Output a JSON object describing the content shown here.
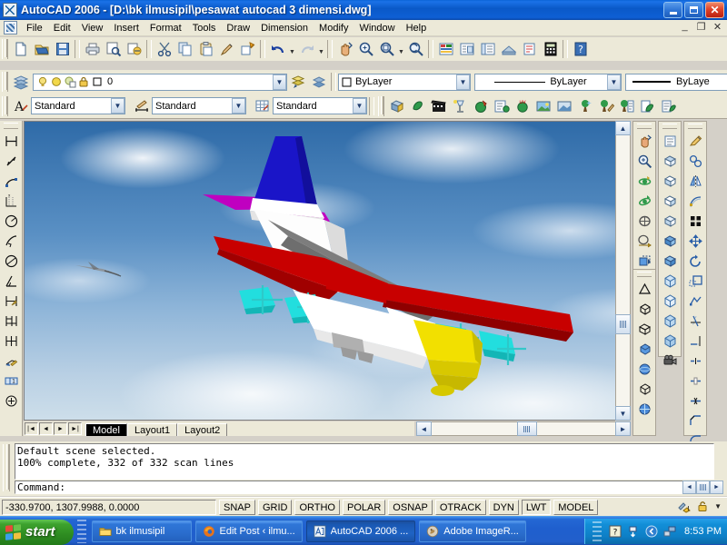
{
  "window": {
    "title": "AutoCAD 2006 - [D:\\bk ilmusipil\\pesawat autocad 3 dimensi.dwg]",
    "app_icon": "autocad-icon",
    "minimize_label": "Minimize",
    "maximize_label": "Restore",
    "close_label": "Close",
    "mdi_minimize": "_",
    "mdi_restore": "❐",
    "mdi_close": "✕"
  },
  "menu": {
    "doc_icon": "document-icon",
    "items": [
      "File",
      "Edit",
      "View",
      "Insert",
      "Format",
      "Tools",
      "Draw",
      "Dimension",
      "Modify",
      "Window",
      "Help"
    ]
  },
  "standard_toolbar": {
    "name": "standard-toolbar",
    "tools": [
      "new-file-icon",
      "open-file-icon",
      "save-icon",
      "plot-icon",
      "plot-preview-icon",
      "publish-icon",
      "cut-icon",
      "copy-icon",
      "paste-icon",
      "match-properties-icon",
      "block-editor-icon",
      "undo-icon",
      "redo-icon",
      "pan-realtime-icon",
      "zoom-realtime-icon",
      "zoom-window-icon",
      "zoom-previous-icon",
      "properties-icon",
      "designcenter-icon",
      "tool-palettes-icon",
      "sheet-set-icon",
      "markup-set-icon",
      "quickcalc-icon",
      "help-icon"
    ]
  },
  "layer_toolbar": {
    "name": "layers-toolbar",
    "layer_properties_icon": "layer-properties-icon",
    "state_icons": [
      "lightbulb-on-icon",
      "sun-freeze-icon",
      "freeze-viewport-icon",
      "lock-icon",
      "color-swatch-icon"
    ],
    "current_layer": "0",
    "make_current_icon": "make-object-layer-current-icon",
    "previous_layer_icon": "layer-previous-icon"
  },
  "properties_toolbar": {
    "name": "properties-toolbar",
    "color": "ByLayer",
    "linetype": "ByLayer",
    "lineweight": "ByLaye",
    "color_swatch_icon": "color-square-icon"
  },
  "styles_toolbar": {
    "name": "styles-toolbar",
    "text_style_icon": "text-style-icon",
    "text_style": "Standard",
    "dim_style_icon": "dimension-style-icon",
    "dim_style": "Standard",
    "table_style_icon": "table-style-icon",
    "table_style": "Standard"
  },
  "render_toolbar": {
    "name": "render-toolbar",
    "tools": [
      "hide-icon",
      "render-icon",
      "scenes-icon",
      "lights-icon",
      "materials-icon",
      "materials-library-icon",
      "mapping-icon",
      "background-icon",
      "fog-icon",
      "landscape-new-icon",
      "landscape-edit-icon",
      "landscape-library-icon",
      "render-preferences-icon",
      "statistics-icon"
    ]
  },
  "dimension_toolbar": {
    "name": "dimension-toolbar",
    "tools": [
      "linear-dimension-icon",
      "aligned-dimension-icon",
      "arc-length-dimension-icon",
      "ordinate-dimension-icon",
      "radius-dimension-icon",
      "jogged-dimension-icon",
      "diameter-dimension-icon",
      "angular-dimension-icon",
      "quick-dimension-icon",
      "baseline-dimension-icon",
      "continue-dimension-icon",
      "quick-leader-icon",
      "tolerance-icon",
      "center-mark-icon"
    ]
  },
  "right_toolbars": {
    "zoom_orbit": {
      "name": "3d-orbit-toolbar",
      "tools": [
        "pan-realtime-icon",
        "zoom-realtime-icon",
        "3d-orbit-icon",
        "3d-continuous-orbit-icon",
        "3d-swivel-icon",
        "3d-adjust-distance-icon",
        "3d-clip-icon",
        "3d-pan-icon",
        "3d-zoom-icon"
      ]
    },
    "view": {
      "name": "view-toolbar",
      "tools": [
        "named-views-icon",
        "top-view-icon",
        "bottom-view-icon",
        "left-view-icon",
        "right-view-icon",
        "front-view-icon",
        "back-view-icon",
        "sw-isometric-icon",
        "se-isometric-icon",
        "ne-isometric-icon",
        "nw-isometric-icon",
        "camera-icon"
      ]
    },
    "solids": {
      "name": "solids-toolbar",
      "tools": [
        "polysolid-icon",
        "box-icon",
        "wedge-icon",
        "cone-icon",
        "sphere-icon",
        "cylinder-icon",
        "torus-icon",
        "extrude-icon",
        "revolve-icon",
        "slice-icon",
        "section-icon",
        "interfere-icon"
      ]
    },
    "modify": {
      "name": "modify-toolbar",
      "tools": [
        "erase-icon",
        "copy-icon",
        "mirror-icon",
        "offset-icon",
        "array-icon",
        "move-icon",
        "rotate-icon",
        "scale-icon",
        "stretch-icon",
        "trim-icon",
        "extend-icon",
        "break-at-point-icon",
        "break-icon",
        "join-icon",
        "chamfer-icon",
        "fillet-icon"
      ]
    }
  },
  "drawing": {
    "name": "model-viewport",
    "content_description": "Rendered 3D airplane over photographic sky background",
    "background": "sky-photo",
    "airplane": {
      "tail_fin_color": "#1a1ad6",
      "tail_plane_color": "#cc00cc",
      "wing_color": "#cc0000",
      "fuselage_color": "#ffffff",
      "nose_color": "#f2e000",
      "engine_color": "#22e0e0",
      "wing_root_color": "#808080"
    },
    "second_aircraft": "distant-airplane"
  },
  "scrollbars": {
    "vertical": {
      "up": "▲",
      "down": "▼"
    },
    "horizontal": {
      "left": "◄",
      "right": "►"
    }
  },
  "layout_tabs": {
    "nav": [
      "first-tab-icon",
      "previous-tab-icon",
      "next-tab-icon",
      "last-tab-icon"
    ],
    "tabs": [
      {
        "label": "Model",
        "active": true
      },
      {
        "label": "Layout1",
        "active": false
      },
      {
        "label": "Layout2",
        "active": false
      }
    ]
  },
  "command_window": {
    "name": "command-window",
    "history": [
      "Default scene selected.",
      "100% complete, 332 of 332 scan lines"
    ],
    "prompt": "Command:",
    "input_value": ""
  },
  "status_bar": {
    "coordinates": "-330.9700, 1307.9988, 0.0000",
    "toggles": [
      {
        "label": "SNAP",
        "pressed": false
      },
      {
        "label": "GRID",
        "pressed": false
      },
      {
        "label": "ORTHO",
        "pressed": false
      },
      {
        "label": "POLAR",
        "pressed": false
      },
      {
        "label": "OSNAP",
        "pressed": false
      },
      {
        "label": "OTRACK",
        "pressed": false
      },
      {
        "label": "DYN",
        "pressed": false
      },
      {
        "label": "LWT",
        "pressed": true
      },
      {
        "label": "MODEL",
        "pressed": false
      }
    ],
    "tray_icons": [
      "communication-center-icon",
      "toolbar-lock-icon"
    ],
    "expand_arrow": "▼"
  },
  "taskbar": {
    "start_label": "start",
    "start_icon": "windows-flag-icon",
    "items": [
      {
        "label": "bk ilmusipil",
        "icon": "folder-icon",
        "active": false
      },
      {
        "label": "Edit Post ‹ ilmu...",
        "icon": "firefox-icon",
        "active": false
      },
      {
        "label": "AutoCAD 2006 ...",
        "icon": "autocad-icon",
        "active": true
      },
      {
        "label": "Adobe ImageR...",
        "icon": "imageready-icon",
        "active": false
      }
    ],
    "tray": {
      "icons": [
        "help-tray-icon",
        "updates-tray-icon",
        "show-hidden-icon",
        "network-icon"
      ],
      "clock": "8:53 PM"
    }
  },
  "colors": {
    "title_blue": "#0a59c8",
    "face": "#ece9d8",
    "taskbar_blue": "#2468d4",
    "start_green": "#3da22e",
    "accent_select": "#316ac5"
  }
}
